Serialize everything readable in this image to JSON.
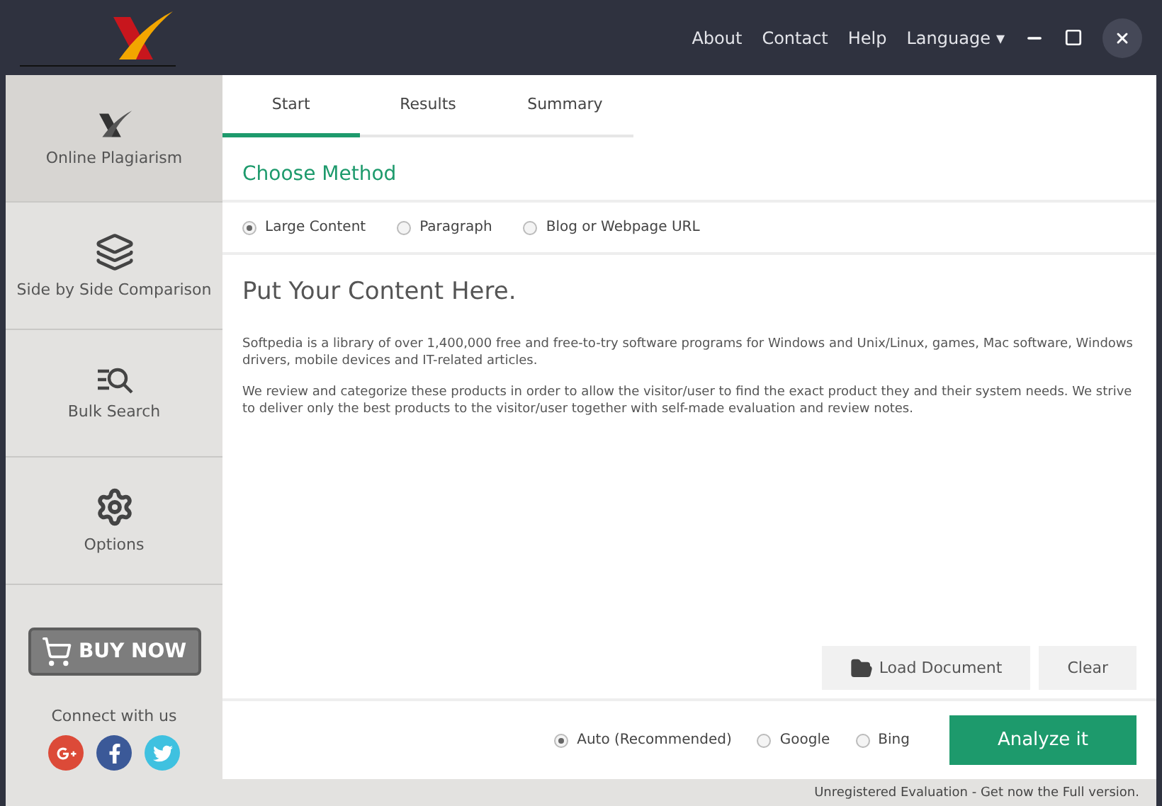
{
  "header": {
    "links": [
      "About",
      "Contact",
      "Help"
    ],
    "language": "Language",
    "caret": "▾"
  },
  "sidebar": {
    "items": [
      {
        "kind": "logo",
        "label": "Online Plagiarism",
        "selected": true
      },
      {
        "kind": "layers",
        "label": "Side by Side Comparison",
        "selected": false
      },
      {
        "kind": "bulk",
        "label": "Bulk Search",
        "selected": false
      },
      {
        "kind": "gear",
        "label": "Options",
        "selected": false
      }
    ],
    "buy": "BUY NOW",
    "connect": "Connect with us",
    "social": [
      {
        "kind": "google"
      },
      {
        "kind": "facebook"
      },
      {
        "kind": "twitter"
      }
    ]
  },
  "tabs": [
    {
      "label": "Start",
      "selected": true
    },
    {
      "label": "Results",
      "selected": false
    },
    {
      "label": "Summary",
      "selected": false
    }
  ],
  "section_title": "Choose Method",
  "methods": [
    {
      "label": "Large Content",
      "selected": true
    },
    {
      "label": "Paragraph",
      "selected": false
    },
    {
      "label": "Blog or Webpage URL",
      "selected": false
    }
  ],
  "content": {
    "heading": "Put Your Content Here.",
    "paragraphs": [
      "Softpedia is a library of over 1,400,000 free and free-to-try software programs for Windows and Unix/Linux, games, Mac software, Windows drivers, mobile devices and IT-related articles.",
      "We review and categorize these products in order to allow the visitor/user to find the exact product they and their system needs. We strive to deliver only the best products to the visitor/user together with self-made evaluation and review notes."
    ]
  },
  "actions": [
    "Load Document",
    "Clear"
  ],
  "engines": [
    {
      "label": "Auto (Recommended)",
      "selected": true
    },
    {
      "label": "Google",
      "selected": false
    },
    {
      "label": "Bing",
      "selected": false
    }
  ],
  "analyze": "Analyze it",
  "status_bar": "Unregistered Evaluation - Get now the Full version."
}
